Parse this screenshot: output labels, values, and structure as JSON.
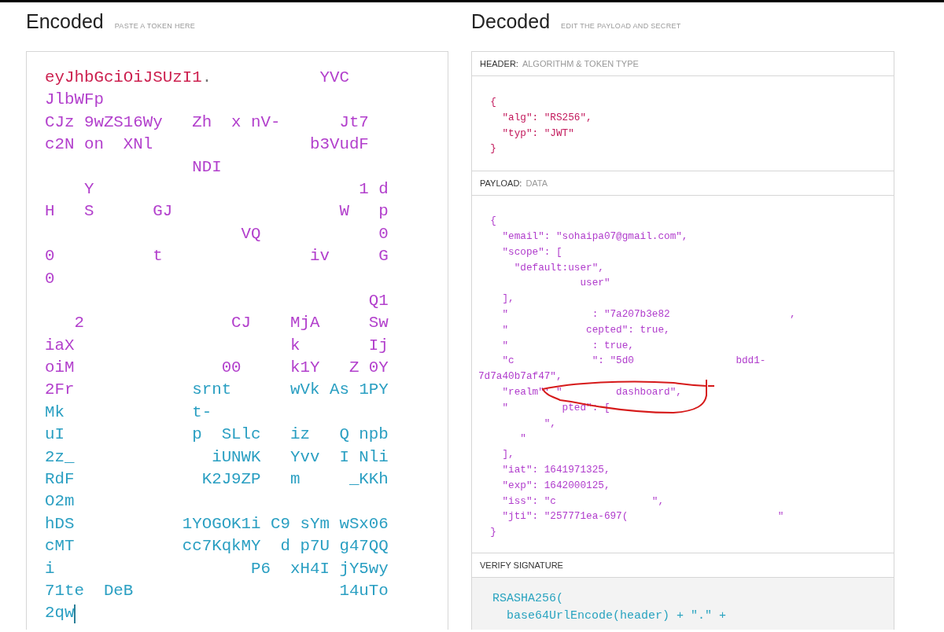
{
  "encoded": {
    "title": "Encoded",
    "subtitle": "PASTE A TOKEN HERE",
    "lines": [
      [
        {
          "text": "eyJhbGciOiJSUzI1",
          "color": "#cc1f4e"
        },
        {
          "text": ".",
          "color": "#777777"
        },
        {
          "text": "           YVC",
          "color": "#b23fcc"
        }
      ],
      [
        {
          "text": "JlbWFp",
          "color": "#b23fcc"
        }
      ],
      [
        {
          "text": "CJz 9wZS16Wy   Zh  x nV-      Jt7",
          "color": "#b23fcc"
        }
      ],
      [
        {
          "text": "c2N on  XNl                b3VudF",
          "color": "#b23fcc"
        }
      ],
      [
        {
          "text": "               NDI",
          "color": "#b23fcc"
        }
      ],
      [
        {
          "text": "    Y                           1 d",
          "color": "#b23fcc"
        }
      ],
      [
        {
          "text": "H   S      GJ                 W   p",
          "color": "#b23fcc"
        }
      ],
      [
        {
          "text": "                    VQ            0",
          "color": "#b23fcc"
        }
      ],
      [
        {
          "text": "0          t               iv     G",
          "color": "#b23fcc"
        }
      ],
      [
        {
          "text": "0",
          "color": "#b23fcc"
        }
      ],
      [
        {
          "text": "                                 Q1",
          "color": "#b23fcc"
        }
      ],
      [
        {
          "text": "   2               CJ    MjA     Sw",
          "color": "#b23fcc"
        }
      ],
      [
        {
          "text": "iaX                      k       Ij",
          "color": "#b23fcc"
        }
      ],
      [
        {
          "text": "oiM               00     k1Y   Z 0Y",
          "color": "#b23fcc"
        }
      ],
      [
        {
          "text": "2Fr",
          "color": "#b23fcc"
        },
        {
          "text": "            srnt      wVk As 1PY",
          "color": "#2a9fc2"
        }
      ],
      [
        {
          "text": "Mk             t-",
          "color": "#2a9fc2"
        }
      ],
      [
        {
          "text": "uI             p  SLlc   iz   Q npb",
          "color": "#2a9fc2"
        }
      ],
      [
        {
          "text": "2z_              iUNWK   Yvv  I Nli",
          "color": "#2a9fc2"
        }
      ],
      [
        {
          "text": "RdF             K2J9ZP   m     _KKh",
          "color": "#2a9fc2"
        }
      ],
      [
        {
          "text": "O2m",
          "color": "#2a9fc2"
        }
      ],
      [
        {
          "text": "hDS           1YOGOK1i C9 sYm wSx06",
          "color": "#2a9fc2"
        }
      ],
      [
        {
          "text": "cMT           cc7KqkMY  d p7U g47QQ",
          "color": "#2a9fc2"
        }
      ],
      [
        {
          "text": "i                    P6  xH4I jY5wy",
          "color": "#2a9fc2"
        }
      ],
      [
        {
          "text": "71te  DeB                     14uTo",
          "color": "#2a9fc2"
        }
      ],
      [
        {
          "text": "2qw",
          "color": "#2a9fc2"
        }
      ]
    ],
    "cursor": true
  },
  "decoded": {
    "title": "Decoded",
    "subtitle": "EDIT THE PAYLOAD AND SECRET",
    "sections": [
      {
        "kind": "header",
        "label": "HEADER:",
        "sublabel": "ALGORITHM & TOKEN TYPE",
        "lines": [
          "  {",
          "    \"alg\": \"RS256\",",
          "    \"typ\": \"JWT\"",
          "  }"
        ]
      },
      {
        "kind": "payload",
        "label": "PAYLOAD:",
        "sublabel": "DATA",
        "lines": [
          "  {",
          "    \"email\": \"sohaipa07@gmail.com\",",
          "    \"scope\": [",
          "      \"default:user\",",
          "                 user\"",
          "    ],",
          "    \"              : \"7a207b3e82                    ,",
          "    \"             cepted\": true,",
          "    \"              : true,",
          "    \"c             \": \"5d0                 bdd1-",
          "7d7a40b7af47\",",
          "    \"realm\": \"         dashboard\",",
          "    \"         pted\": [",
          "           \",",
          "       \"",
          "    ],",
          "    \"iat\": 1641971325,",
          "    \"exp\": 1642000125,",
          "    \"iss\": \"c                \",",
          "    \"jti\": \"257771ea-697(                         \"",
          "  }"
        ]
      },
      {
        "kind": "signature",
        "label": "VERIFY SIGNATURE",
        "lines": [
          "  RSASHA256(",
          "    base64UrlEncode(header) + \".\" +"
        ]
      }
    ]
  }
}
